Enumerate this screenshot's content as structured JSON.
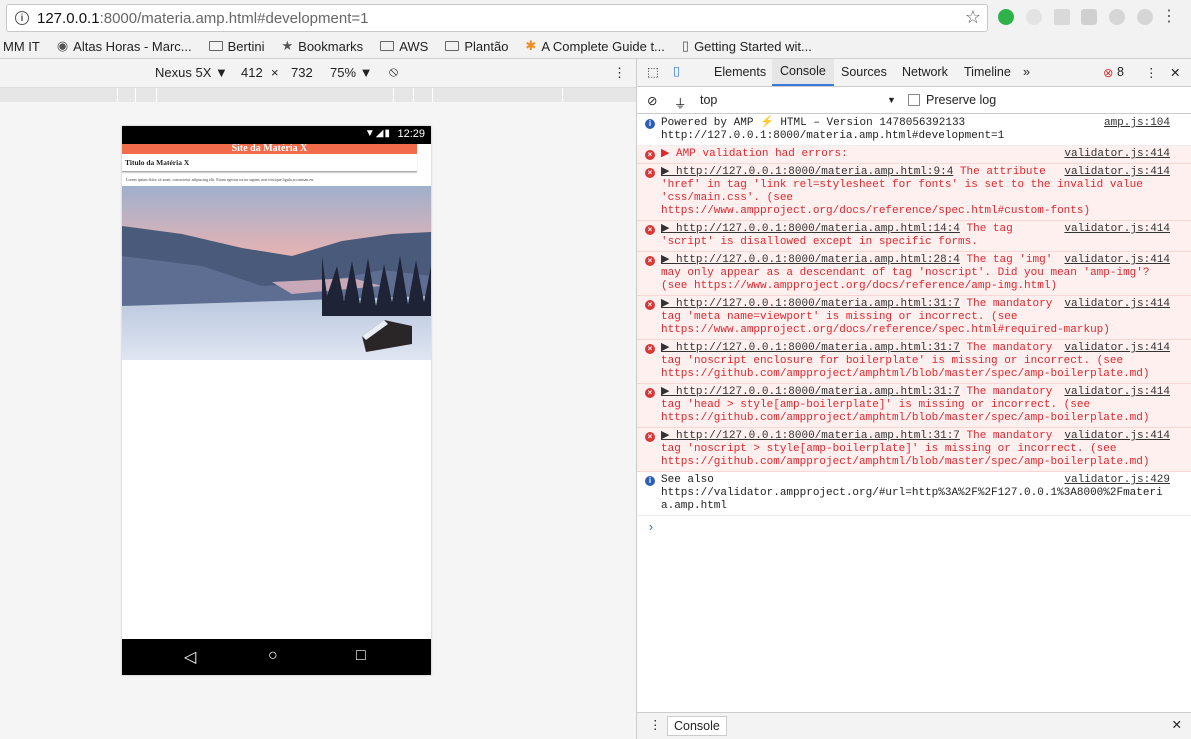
{
  "browser": {
    "url_host": "127.0.0.1",
    "url_rest": ":8000/materia.amp.html#development=1"
  },
  "bookmarks": [
    {
      "label": "MM IT"
    },
    {
      "label": "Altas Horas - Marc..."
    },
    {
      "label": "Bertini"
    },
    {
      "label": "Bookmarks"
    },
    {
      "label": "AWS"
    },
    {
      "label": "Plantão"
    },
    {
      "label": "A Complete Guide t..."
    },
    {
      "label": "Getting Started wit..."
    }
  ],
  "device_toolbar": {
    "device": "Nexus 5X ▼",
    "width": "412",
    "times": "×",
    "height": "732",
    "zoom": "75% ▼"
  },
  "phone": {
    "time": "12:29",
    "site_header": "Site da Matéria X",
    "article_title": "Titulo da Matéria X",
    "article_text": "Lorem ipsum dolor sit amet, consectetur adipiscing elit. Etiam egestas tortor sapien, non tristique ligula accumsan eu."
  },
  "devtools": {
    "tabs": [
      "Elements",
      "Console",
      "Sources",
      "Network",
      "Timeline",
      "»"
    ],
    "error_count": "8",
    "context": "top",
    "preserve_log": "Preserve log",
    "drawer_tab": "Console",
    "messages": [
      {
        "type": "info",
        "text": "Powered by AMP ⚡ HTML – Version 1478056392133\nhttp://127.0.0.1:8000/materia.amp.html#development=1",
        "src": "amp.js:104"
      },
      {
        "type": "err",
        "text": "▶ AMP validation had errors:",
        "src": "validator.js:414"
      },
      {
        "type": "err",
        "link": "▶ http://127.0.0.1:8000/materia.amp.html:9:4",
        "text": " The attribute\n'href' in tag 'link rel=stylesheet for fonts' is set to the invalid value\n'css/main.css'. (see\nhttps://www.ampproject.org/docs/reference/spec.html#custom-fonts)",
        "src": "validator.js:414"
      },
      {
        "type": "err",
        "link": "▶ http://127.0.0.1:8000/materia.amp.html:14:4",
        "text": " The tag\n'script' is disallowed except in specific forms.",
        "src": "validator.js:414"
      },
      {
        "type": "err",
        "link": "▶ http://127.0.0.1:8000/materia.amp.html:28:4",
        "text": " The tag 'img'\nmay only appear as a descendant of tag 'noscript'. Did you mean 'amp-img'?\n(see https://www.ampproject.org/docs/reference/amp-img.html)",
        "src": "validator.js:414"
      },
      {
        "type": "err",
        "link": "▶ http://127.0.0.1:8000/materia.amp.html:31:7",
        "text": " The mandatory\ntag 'meta name=viewport' is missing or incorrect. (see\nhttps://www.ampproject.org/docs/reference/spec.html#required-markup)",
        "src": "validator.js:414"
      },
      {
        "type": "err",
        "link": "▶ http://127.0.0.1:8000/materia.amp.html:31:7",
        "text": " The mandatory\ntag 'noscript enclosure for boilerplate' is missing or incorrect. (see\nhttps://github.com/ampproject/amphtml/blob/master/spec/amp-boilerplate.md)",
        "src": "validator.js:414"
      },
      {
        "type": "err",
        "link": "▶ http://127.0.0.1:8000/materia.amp.html:31:7",
        "text": " The mandatory\ntag 'head > style[amp-boilerplate]' is missing or incorrect. (see\nhttps://github.com/ampproject/amphtml/blob/master/spec/amp-boilerplate.md)",
        "src": "validator.js:414"
      },
      {
        "type": "err",
        "link": "▶ http://127.0.0.1:8000/materia.amp.html:31:7",
        "text": " The mandatory\ntag 'noscript > style[amp-boilerplate]' is missing or incorrect. (see\nhttps://github.com/ampproject/amphtml/blob/master/spec/amp-boilerplate.md)",
        "src": "validator.js:414"
      },
      {
        "type": "info",
        "text": "See also\nhttps://validator.ampproject.org/#url=http%3A%2F%2F127.0.0.1%3A8000%2Fmateri\na.amp.html",
        "src": "validator.js:429"
      }
    ]
  }
}
